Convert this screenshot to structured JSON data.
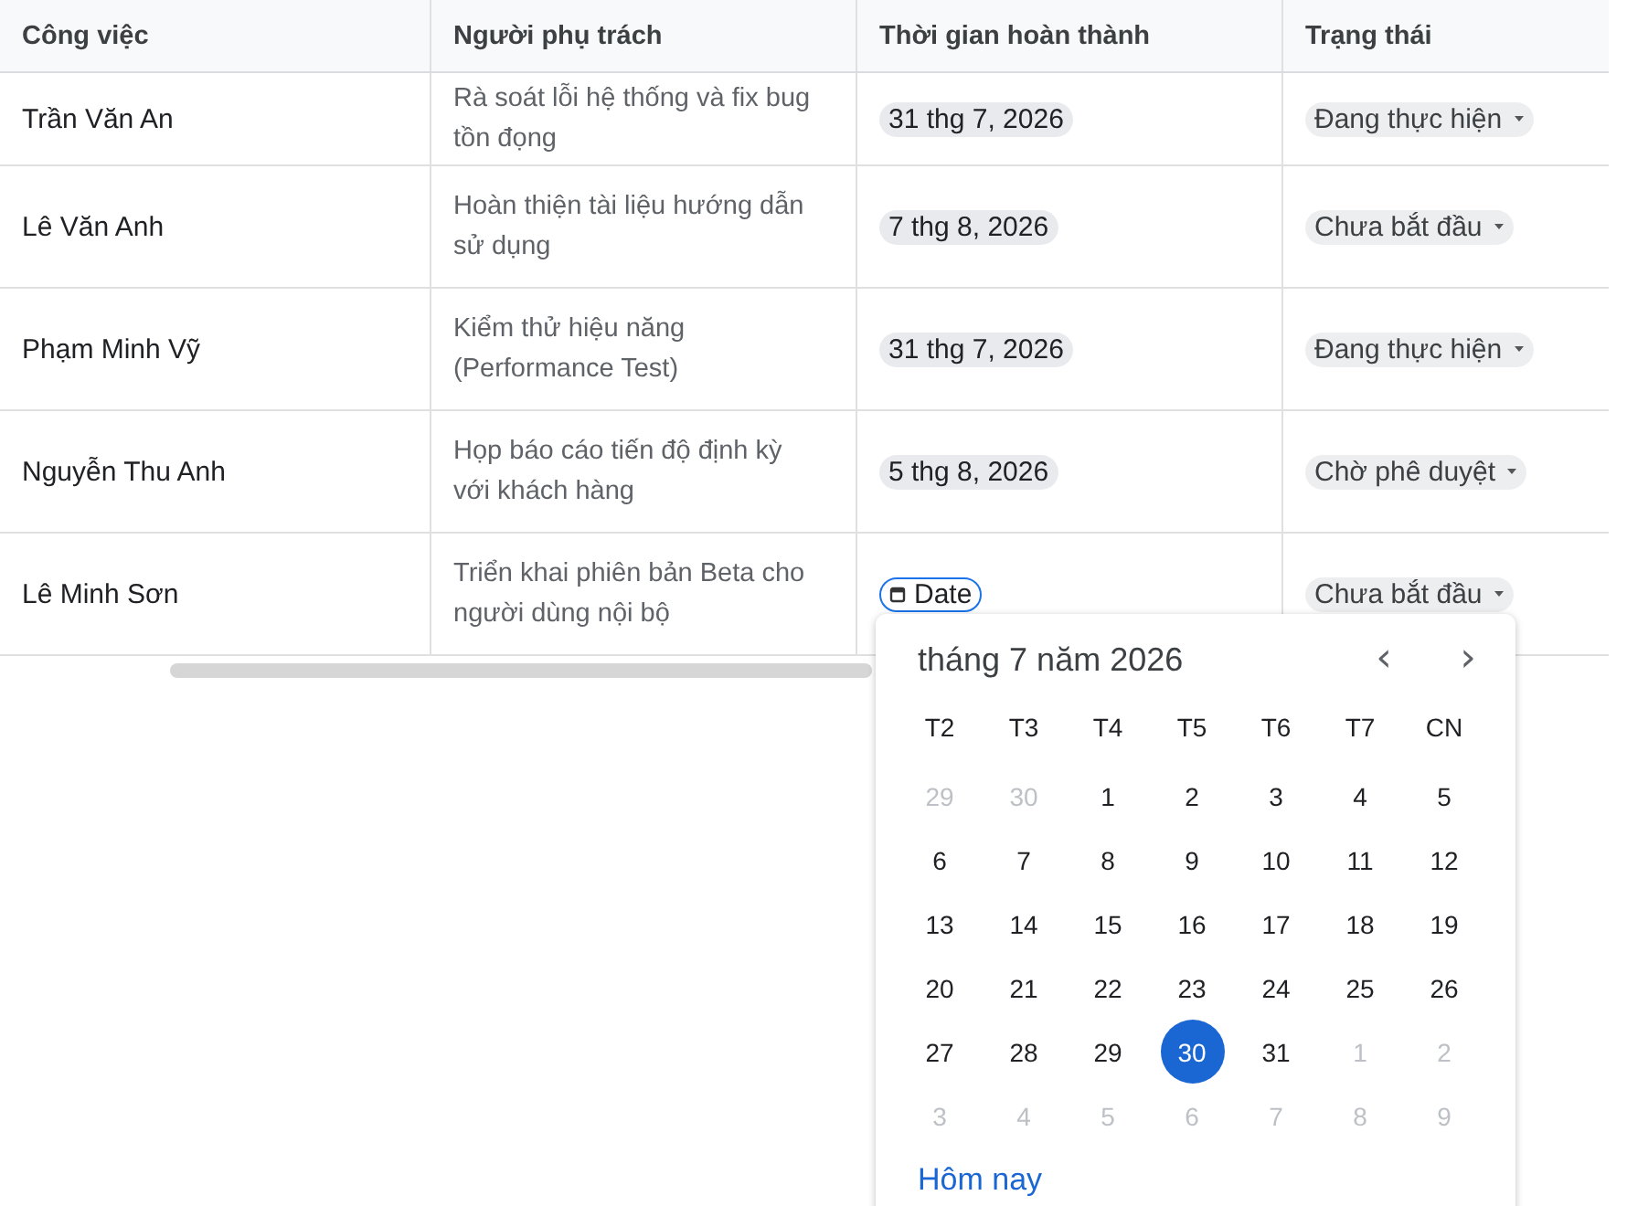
{
  "table": {
    "columns": [
      "Công việc",
      "Người phụ trách",
      "Thời gian hoàn thành",
      "Trạng thái"
    ],
    "rows": [
      {
        "name": "Trần Văn An",
        "task": "Rà soát lỗi hệ thống và fix bug tồn đọng",
        "date": {
          "label": "31 thg 7, 2026",
          "focused": false
        },
        "status": "Đang thực hiện"
      },
      {
        "name": "Lê Văn Anh",
        "task": "Hoàn thiện tài liệu hướng dẫn sử dụng",
        "date": {
          "label": "7 thg 8, 2026",
          "focused": false
        },
        "status": "Chưa bắt đầu"
      },
      {
        "name": "Phạm Minh Vỹ",
        "task": "Kiểm thử hiệu năng (Performance Test)",
        "date": {
          "label": "31 thg 7, 2026",
          "focused": false
        },
        "status": "Đang thực hiện"
      },
      {
        "name": "Nguyễn Thu Anh",
        "task": "Họp báo cáo tiến độ định kỳ với khách hàng",
        "date": {
          "label": "5 thg 8, 2026",
          "focused": false
        },
        "status": "Chờ phê duyệt"
      },
      {
        "name": "Lê Minh Sơn",
        "task": "Triển khai phiên bản Beta cho người dùng nội bộ",
        "date": {
          "label": "Date",
          "focused": true
        },
        "status": "Chưa bắt đầu"
      }
    ]
  },
  "calendar": {
    "title": "tháng 7 năm 2026",
    "prev": "‹",
    "next": "›",
    "weekdays": [
      "T2",
      "T3",
      "T4",
      "T5",
      "T6",
      "T7",
      "CN"
    ],
    "weeks": [
      [
        {
          "day": "29",
          "muted": true,
          "selected": false
        },
        {
          "day": "30",
          "muted": true,
          "selected": false
        },
        {
          "day": "1",
          "muted": false,
          "selected": false
        },
        {
          "day": "2",
          "muted": false,
          "selected": false
        },
        {
          "day": "3",
          "muted": false,
          "selected": false
        },
        {
          "day": "4",
          "muted": false,
          "selected": false
        },
        {
          "day": "5",
          "muted": false,
          "selected": false
        }
      ],
      [
        {
          "day": "6",
          "muted": false,
          "selected": false
        },
        {
          "day": "7",
          "muted": false,
          "selected": false
        },
        {
          "day": "8",
          "muted": false,
          "selected": false
        },
        {
          "day": "9",
          "muted": false,
          "selected": false
        },
        {
          "day": "10",
          "muted": false,
          "selected": false
        },
        {
          "day": "11",
          "muted": false,
          "selected": false
        },
        {
          "day": "12",
          "muted": false,
          "selected": false
        }
      ],
      [
        {
          "day": "13",
          "muted": false,
          "selected": false
        },
        {
          "day": "14",
          "muted": false,
          "selected": false
        },
        {
          "day": "15",
          "muted": false,
          "selected": false
        },
        {
          "day": "16",
          "muted": false,
          "selected": false
        },
        {
          "day": "17",
          "muted": false,
          "selected": false
        },
        {
          "day": "18",
          "muted": false,
          "selected": false
        },
        {
          "day": "19",
          "muted": false,
          "selected": false
        }
      ],
      [
        {
          "day": "20",
          "muted": false,
          "selected": false
        },
        {
          "day": "21",
          "muted": false,
          "selected": false
        },
        {
          "day": "22",
          "muted": false,
          "selected": false
        },
        {
          "day": "23",
          "muted": false,
          "selected": false
        },
        {
          "day": "24",
          "muted": false,
          "selected": false
        },
        {
          "day": "25",
          "muted": false,
          "selected": false
        },
        {
          "day": "26",
          "muted": false,
          "selected": false
        }
      ],
      [
        {
          "day": "27",
          "muted": false,
          "selected": false
        },
        {
          "day": "28",
          "muted": false,
          "selected": false
        },
        {
          "day": "29",
          "muted": false,
          "selected": false
        },
        {
          "day": "30",
          "muted": false,
          "selected": true
        },
        {
          "day": "31",
          "muted": false,
          "selected": false
        },
        {
          "day": "1",
          "muted": true,
          "selected": false
        },
        {
          "day": "2",
          "muted": true,
          "selected": false
        }
      ],
      [
        {
          "day": "3",
          "muted": true,
          "selected": false
        },
        {
          "day": "4",
          "muted": true,
          "selected": false
        },
        {
          "day": "5",
          "muted": true,
          "selected": false
        },
        {
          "day": "6",
          "muted": true,
          "selected": false
        },
        {
          "day": "7",
          "muted": true,
          "selected": false
        },
        {
          "day": "8",
          "muted": true,
          "selected": false
        },
        {
          "day": "9",
          "muted": true,
          "selected": false
        }
      ]
    ],
    "today": "Hôm nay"
  }
}
